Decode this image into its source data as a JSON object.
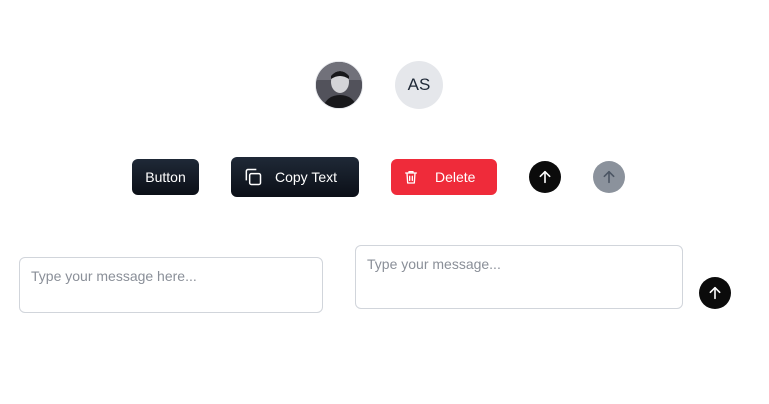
{
  "avatars": {
    "photo_alt": "User photo",
    "initials": "AS"
  },
  "buttons": {
    "primary_label": "Button",
    "copy_label": "Copy Text",
    "delete_label": "Delete"
  },
  "icons": {
    "copy": "copy-icon",
    "delete": "trash-icon",
    "send": "arrow-up-icon"
  },
  "inputs": {
    "message_placeholder_1": "Type your message here...",
    "message_placeholder_2": "Type your message..."
  },
  "colors": {
    "dark": "#0b0f17",
    "danger": "#ef2b3a",
    "disabled": "#8b929c",
    "avatar_bg": "#e5e7eb"
  }
}
